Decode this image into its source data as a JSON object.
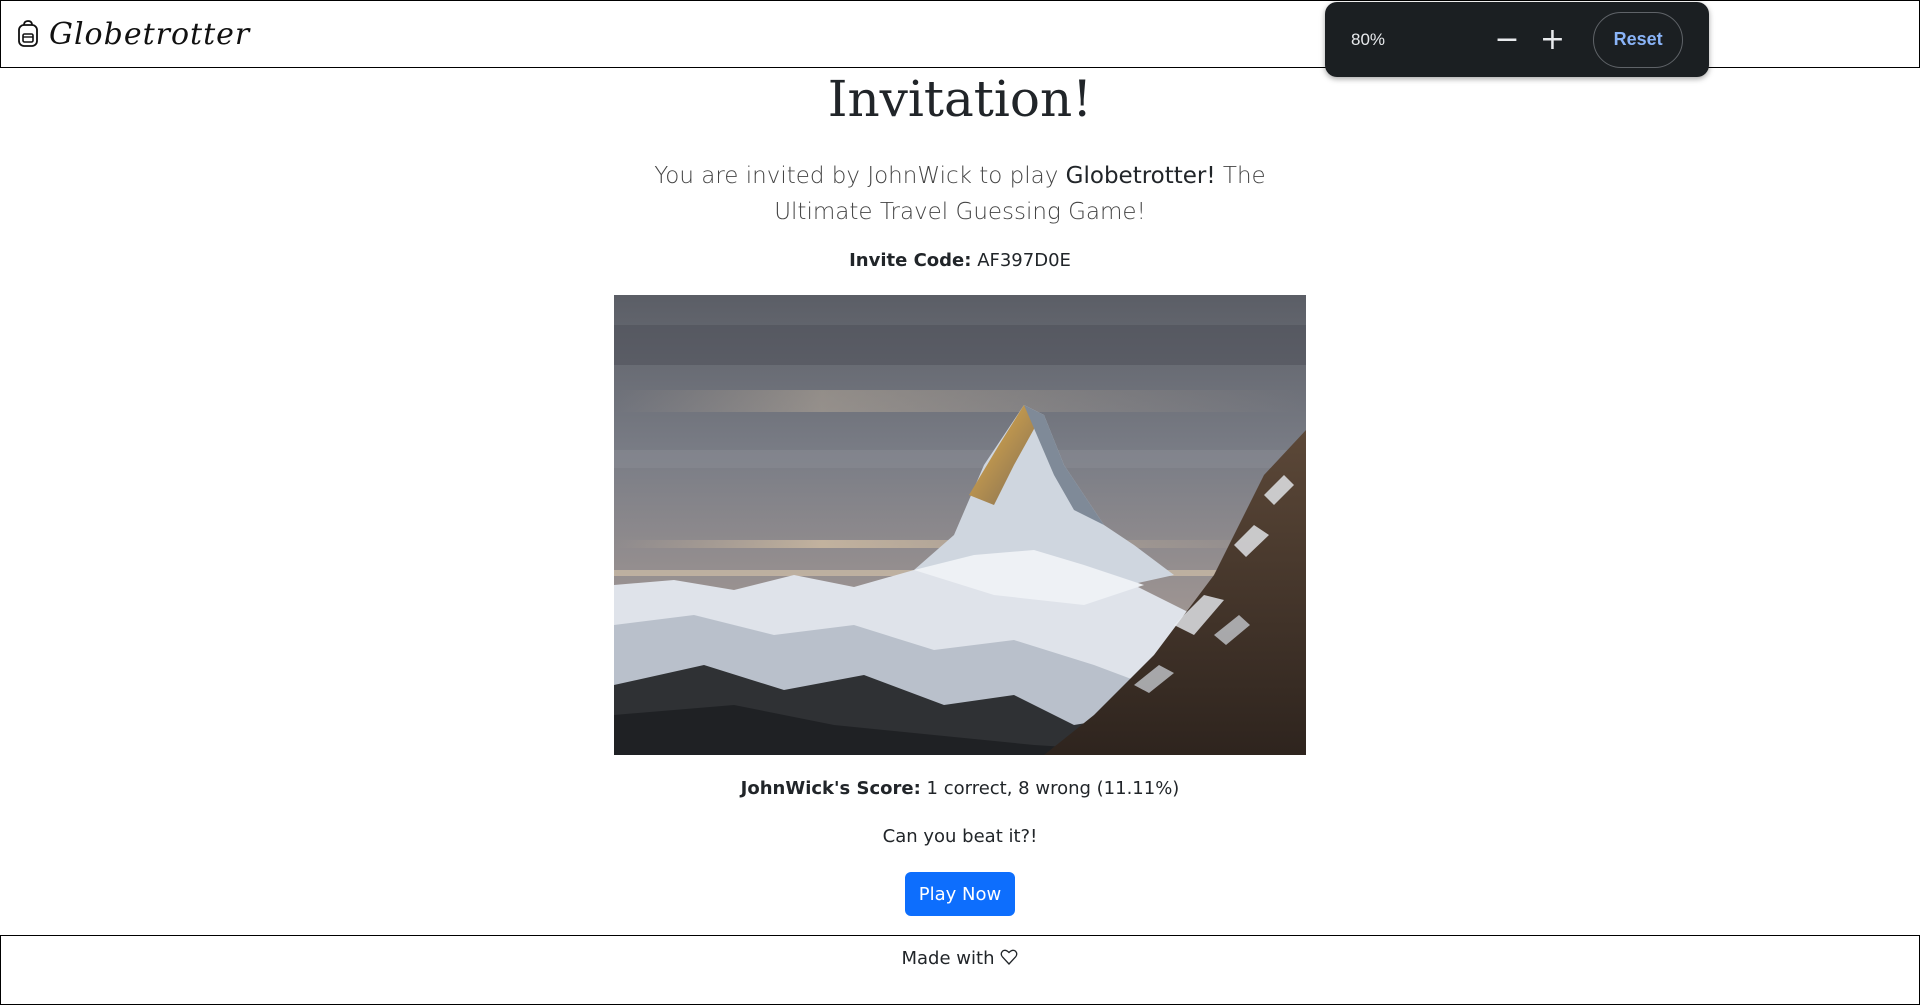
{
  "header": {
    "brand": "Globetrotter",
    "brand_icon": "backpack-icon"
  },
  "zoom": {
    "level": "80%",
    "minus_label": "−",
    "plus_label": "+",
    "reset_label": "Reset",
    "accent": "#8ab4f8"
  },
  "main": {
    "title": "Invitation!",
    "lead_prefix": "You are invited by JohnWick to play ",
    "lead_game": "Globetrotter!",
    "lead_suffix": " The Ultimate Travel Guessing Game!",
    "invite_label": "Invite Code:",
    "invite_code": "AF397D0E",
    "image_alt": "mountain-photo",
    "score_label": "JohnWick's Score:",
    "score_value": "1 correct, 8 wrong (11.11%)",
    "challenge": "Can you beat it?!",
    "play_button": "Play Now",
    "primary_color": "#0d6efd"
  },
  "footer": {
    "text": "Made with",
    "icon": "heart-icon"
  }
}
